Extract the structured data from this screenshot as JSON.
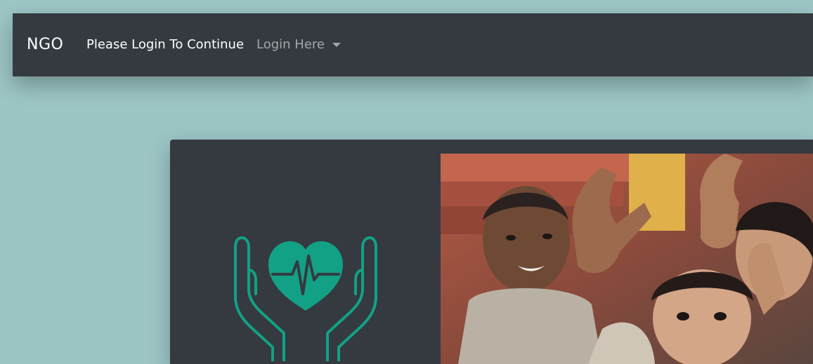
{
  "navbar": {
    "brand": "NGO",
    "message": "Please Login To Continue",
    "dropdown_label": "Login Here",
    "dropdown_icon": "chevron-down-icon"
  },
  "hero": {
    "logo_icon": "hands-heart-pulse-icon",
    "logo_color": "#12a184",
    "photo_subject": "children-smiling-photo"
  },
  "colors": {
    "page_background": "#9cc5c4",
    "navbar_background": "#343a40",
    "card_background": "#343a40",
    "accent": "#12a184"
  }
}
